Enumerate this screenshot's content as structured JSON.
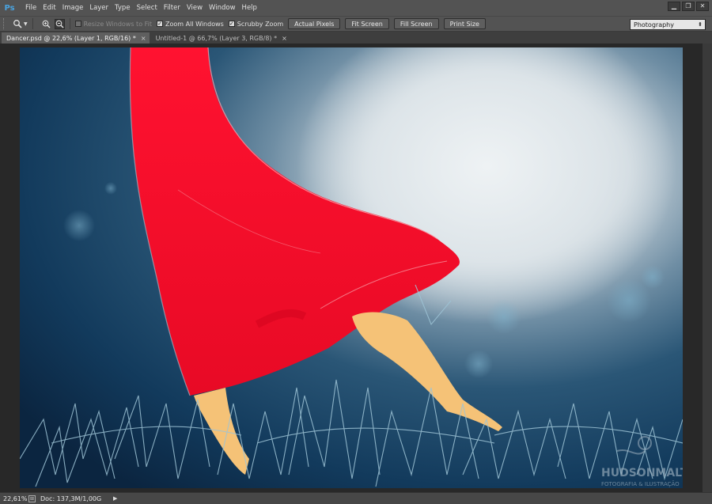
{
  "app": {
    "logo": "Ps",
    "menu": [
      "File",
      "Edit",
      "Image",
      "Layer",
      "Type",
      "Select",
      "Filter",
      "View",
      "Window",
      "Help"
    ],
    "window_controls": {
      "minimize": "▁",
      "restore": "❐",
      "close": "✕"
    }
  },
  "options": {
    "resize_windows": "Resize Windows to Fit",
    "zoom_all": "Zoom All Windows",
    "scrubby": "Scrubby Zoom",
    "actual_pixels": "Actual Pixels",
    "fit_screen": "Fit Screen",
    "fill_screen": "Fill Screen",
    "print_size": "Print Size",
    "workspace": "Photography",
    "check_mark": "✓"
  },
  "tabs": [
    {
      "label": "Dancer.psd @ 22,6% (Layer 1, RGB/16) *",
      "close": "×"
    },
    {
      "label": "Untitled-1 @ 66,7% (Layer 3, RGB/8) *",
      "close": "×"
    }
  ],
  "watermark": {
    "name": "HUDSONMALTA",
    "tagline": "FOTOGRAFIA & ILUSTRAÇÃO"
  },
  "status": {
    "zoom": "22,61%",
    "doc": "Doc: 137,3M/1,00G",
    "arrow": "▶"
  },
  "colors": {
    "dress": "#f0102a",
    "legs": "#f5c277",
    "sky_dark": "#123456",
    "moon": "#dfe6ea",
    "grass": "#9ec4d6"
  }
}
